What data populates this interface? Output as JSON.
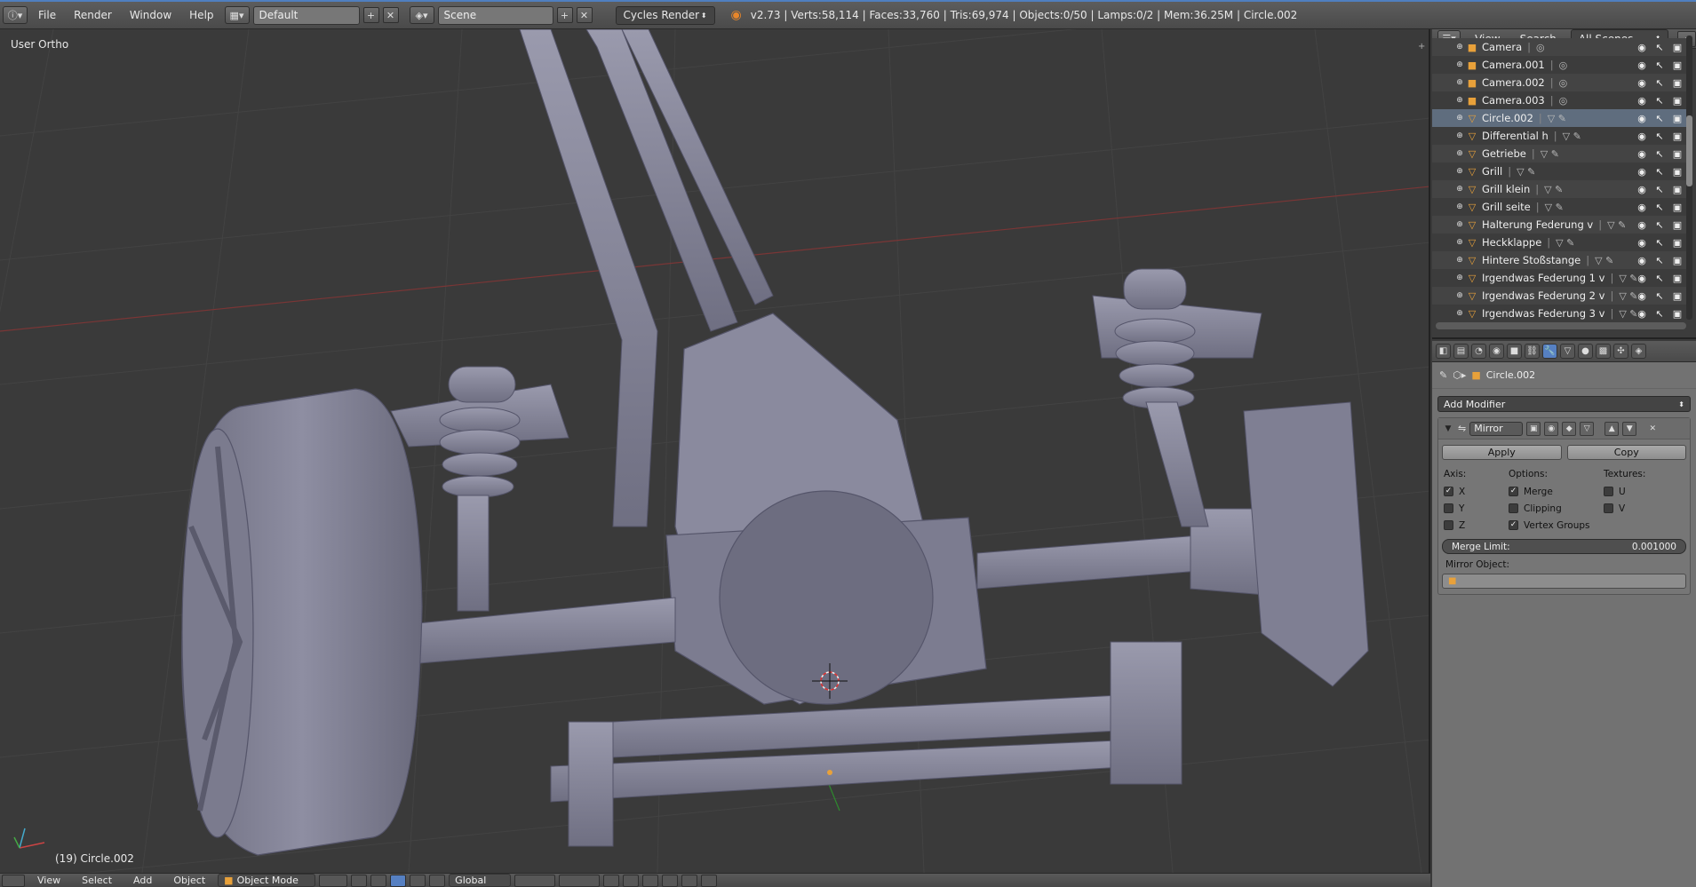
{
  "topbar": {
    "menus": [
      "File",
      "Render",
      "Window",
      "Help"
    ],
    "screen_layout": "Default",
    "scene": "Scene",
    "render_engine": "Cycles Render",
    "stats": "v2.73 | Verts:58,114 | Faces:33,760 | Tris:69,974 | Objects:0/50 | Lamps:0/2 | Mem:36.25M | Circle.002"
  },
  "viewport": {
    "view_label": "User Ortho",
    "object_label": "(19) Circle.002"
  },
  "bottombar": {
    "menus": [
      "View",
      "Select",
      "Add",
      "Object"
    ],
    "mode": "Object Mode",
    "orientation": "Global"
  },
  "outliner": {
    "menus": [
      "View",
      "Search"
    ],
    "display_mode": "All Scenes",
    "rows": [
      {
        "name": "Camera",
        "type": "camera",
        "selected": false
      },
      {
        "name": "Camera.001",
        "type": "camera",
        "selected": false
      },
      {
        "name": "Camera.002",
        "type": "camera",
        "selected": false
      },
      {
        "name": "Camera.003",
        "type": "camera",
        "selected": false
      },
      {
        "name": "Circle.002",
        "type": "mesh",
        "selected": true
      },
      {
        "name": "Differential h",
        "type": "mesh",
        "selected": false
      },
      {
        "name": "Getriebe",
        "type": "mesh",
        "selected": false
      },
      {
        "name": "Grill",
        "type": "mesh",
        "selected": false
      },
      {
        "name": "Grill klein",
        "type": "mesh",
        "selected": false
      },
      {
        "name": "Grill seite",
        "type": "mesh",
        "selected": false
      },
      {
        "name": "Halterung Federung v",
        "type": "mesh",
        "selected": false
      },
      {
        "name": "Heckklappe",
        "type": "mesh",
        "selected": false
      },
      {
        "name": "Hintere Stoßstange",
        "type": "mesh",
        "selected": false
      },
      {
        "name": "Irgendwas Federung 1 v",
        "type": "mesh",
        "selected": false
      },
      {
        "name": "Irgendwas Federung 2 v",
        "type": "mesh",
        "selected": false
      },
      {
        "name": "Irgendwas Federung 3 v",
        "type": "mesh",
        "selected": false
      }
    ]
  },
  "properties": {
    "context_object": "Circle.002",
    "add_modifier": "Add Modifier",
    "modifier": {
      "name": "Mirror",
      "apply": "Apply",
      "copy": "Copy",
      "axis_label": "Axis:",
      "options_label": "Options:",
      "textures_label": "Textures:",
      "axes": [
        {
          "label": "X",
          "checked": true
        },
        {
          "label": "Y",
          "checked": false
        },
        {
          "label": "Z",
          "checked": false
        }
      ],
      "options": [
        {
          "label": "Merge",
          "checked": true
        },
        {
          "label": "Clipping",
          "checked": false
        },
        {
          "label": "Vertex Groups",
          "checked": true
        }
      ],
      "textures": [
        {
          "label": "U",
          "checked": false
        },
        {
          "label": "V",
          "checked": false
        }
      ],
      "merge_limit_label": "Merge Limit:",
      "merge_limit_value": "0.001000",
      "mirror_object_label": "Mirror Object:"
    }
  },
  "colors": {
    "accent_blue": "#5680c2",
    "selection_row": "#5f6d7e",
    "mesh_icon": "#e8a13a",
    "model_gray": "#8a8a9c"
  }
}
